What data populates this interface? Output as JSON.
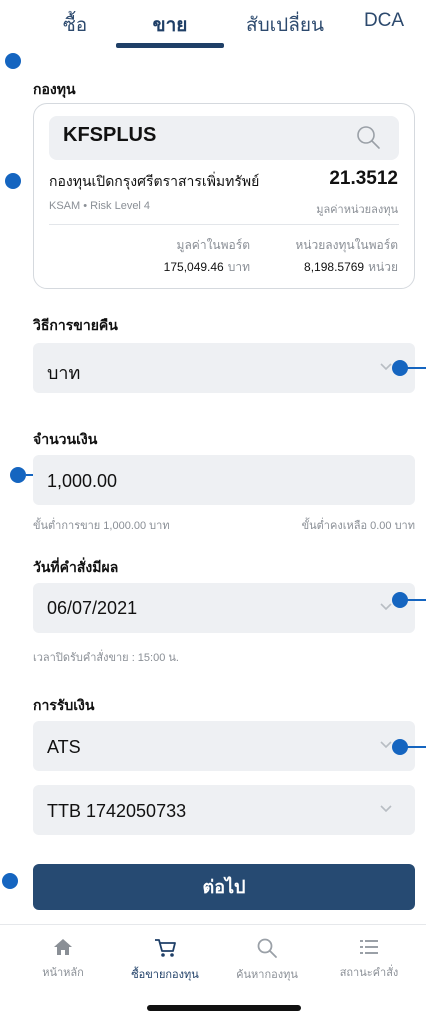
{
  "tabs": [
    {
      "label": "ซื้อ"
    },
    {
      "label": "ขาย"
    },
    {
      "label": "สับเปลี่ยน"
    },
    {
      "label": "DCA"
    }
  ],
  "fund": {
    "section_label": "กองทุน",
    "code": "KFSPLUS",
    "name": "กองทุนเปิดกรุงศรีตราสารเพิ่มทรัพย์",
    "nav": "21.3512",
    "meta": "KSAM • Risk Level 4",
    "nav_label": "มูลค่าหน่วยลงทุน",
    "portfolio_value_label": "มูลค่าในพอร์ต",
    "portfolio_value": "175,049.46",
    "portfolio_value_unit": "บาท",
    "units_label": "หน่วยลงทุนในพอร์ต",
    "units": "8,198.5769",
    "units_unit": "หน่วย"
  },
  "redeem_method": {
    "label": "วิธีการขายคืน",
    "value": "บาท"
  },
  "amount": {
    "label": "จำนวนเงิน",
    "value": "1,000.00",
    "min_hint": "ขั้นต่ำการขาย 1,000.00 บาท",
    "remaining_hint": "ขั้นต่ำคงเหลือ 0.00 บาท"
  },
  "effective_date": {
    "label": "วันที่คำสั่งมีผล",
    "value": "06/07/2021",
    "cutoff_hint": "เวลาปิดรับคำสั่งขาย : 15:00 น."
  },
  "receive": {
    "label": "การรับเงิน",
    "method": "ATS",
    "account": "TTB 1742050733"
  },
  "next_button": "ต่อไป",
  "bottom_nav": [
    {
      "label": "หน้าหลัก",
      "icon": "home-icon"
    },
    {
      "label": "ซื้อขายกองทุน",
      "icon": "cart-icon"
    },
    {
      "label": "ค้นหากองทุน",
      "icon": "search-icon"
    },
    {
      "label": "สถานะคำสั่ง",
      "icon": "list-icon"
    }
  ],
  "colors": {
    "primary": "#264a72",
    "annotation": "#1565c0",
    "field_bg": "#eef0f3"
  }
}
